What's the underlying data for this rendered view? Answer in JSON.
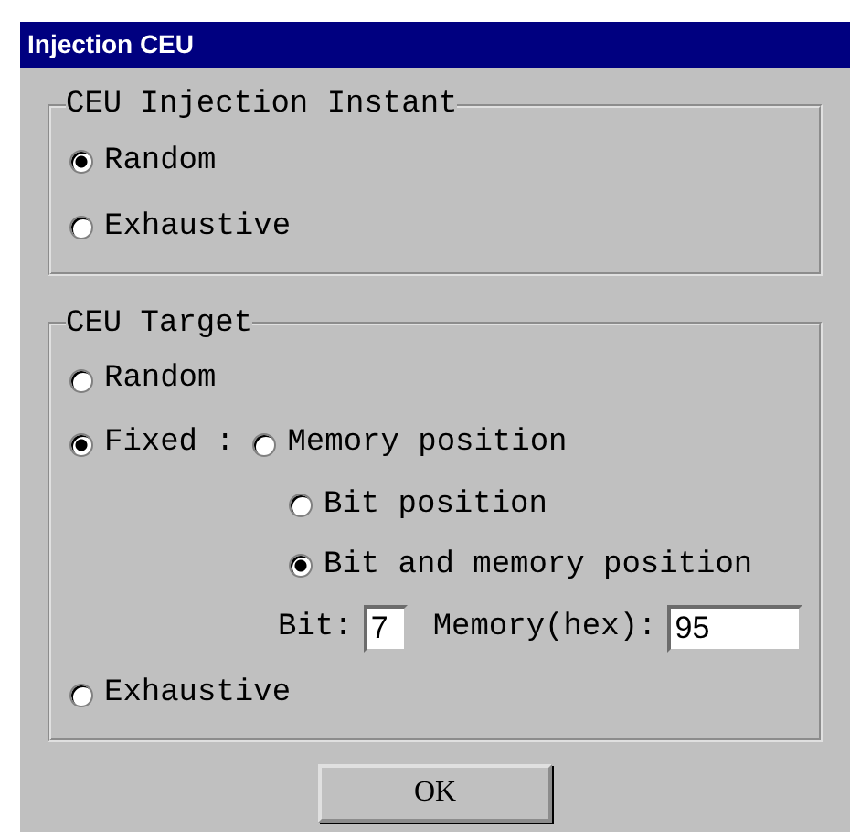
{
  "window": {
    "title": "Injection CEU"
  },
  "groups": [
    {
      "title": "CEU Injection Instant",
      "options": [
        {
          "kind": "plain",
          "label": "Random",
          "selected": true
        },
        {
          "kind": "plain",
          "label": "Exhaustive",
          "selected": false
        }
      ]
    },
    {
      "title": "CEU Target",
      "options": [
        {
          "kind": "plain",
          "label": "Random",
          "selected": false
        },
        {
          "kind": "fixed",
          "label": "Fixed",
          "selected": true,
          "separator": ":",
          "sub_options": [
            {
              "label": "Memory position",
              "selected": false
            },
            {
              "label": "Bit position",
              "selected": false
            },
            {
              "label": "Bit and memory position",
              "selected": true
            }
          ],
          "fields": [
            {
              "label": "Bit:",
              "value": "7",
              "kind": "narrow"
            },
            {
              "label": "Memory(hex):",
              "value": "95",
              "kind": "wide"
            }
          ]
        },
        {
          "kind": "plain",
          "label": "Exhaustive",
          "selected": false
        }
      ]
    }
  ],
  "buttons": [
    {
      "label": "OK"
    }
  ]
}
